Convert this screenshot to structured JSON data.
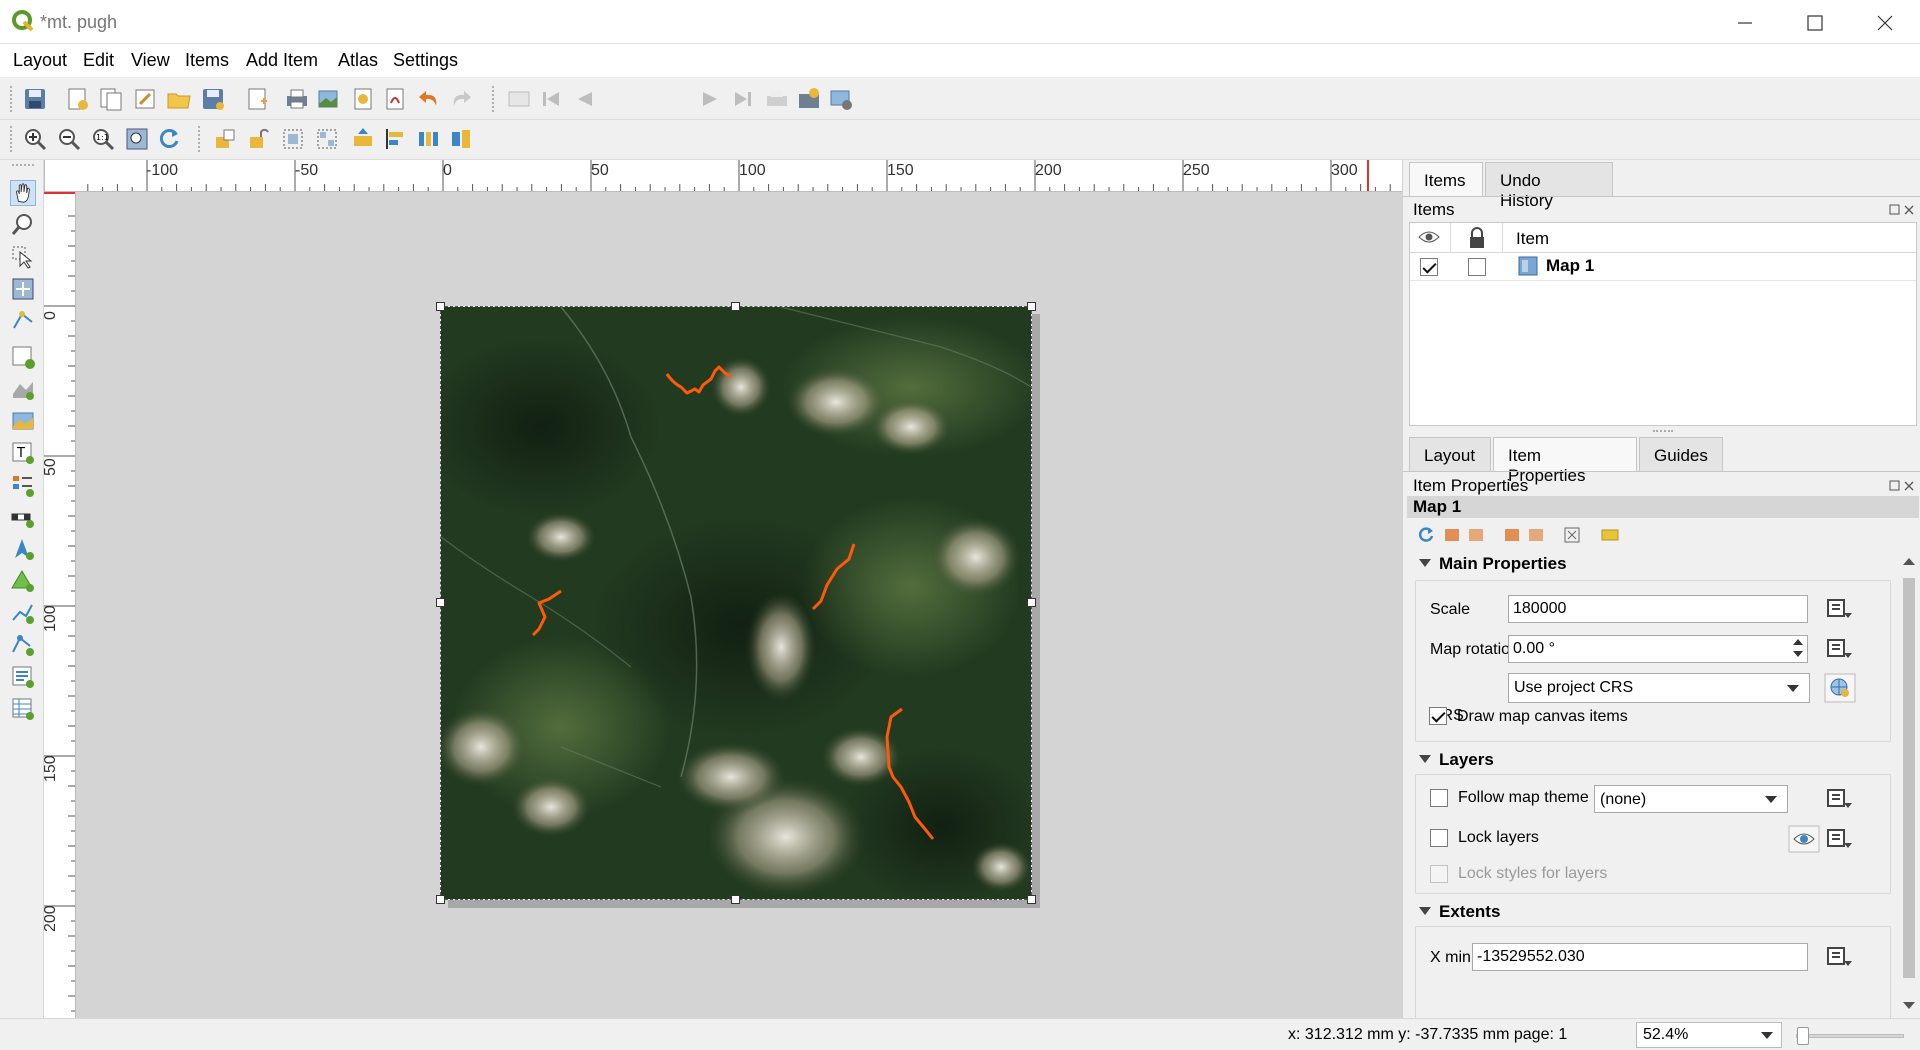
{
  "window": {
    "title": "*mt. pugh"
  },
  "menu": [
    "Layout",
    "Edit",
    "View",
    "Items",
    "Add Item",
    "Atlas",
    "Settings"
  ],
  "toolbar": {
    "page_number": "1"
  },
  "ruler": {
    "h_labels": [
      "-100",
      "-50",
      "0",
      "50",
      "100",
      "150",
      "200",
      "250",
      "300"
    ],
    "v_labels": [
      "0",
      "50",
      "100",
      "150",
      "200"
    ]
  },
  "dock": {
    "top_tabs": [
      "Items",
      "Undo History"
    ],
    "items_panel_title": "Items",
    "items_header": "Item",
    "items": [
      {
        "name": "Map 1",
        "visible": true,
        "locked": false
      }
    ],
    "bottom_tabs": [
      "Layout",
      "Item Properties",
      "Guides"
    ],
    "props_panel_title": "Item Properties",
    "selected_item": "Map 1"
  },
  "properties": {
    "main_title": "Main Properties",
    "scale_label": "Scale",
    "scale_value": "180000",
    "rotation_label": "Map rotation",
    "rotation_value": "0.00 °",
    "crs_combo": "Use project CRS",
    "crs_label": "CRS",
    "draw_canvas_label": "Draw map canvas items",
    "draw_canvas_checked": true,
    "layers_title": "Layers",
    "follow_theme_label": "Follow map theme",
    "theme_value": "(none)",
    "lock_layers_label": "Lock layers",
    "lock_styles_label": "Lock styles for layers",
    "extents_title": "Extents",
    "xmin_label": "X min",
    "xmin_value": "-13529552.030"
  },
  "status": {
    "coords": "x: 312.312 mm y: -37.7335 mm page: 1",
    "zoom": "52.4%"
  },
  "colors": {
    "accent_trail": "#ff5a0a",
    "canvas_bg": "#d4d4d4"
  }
}
